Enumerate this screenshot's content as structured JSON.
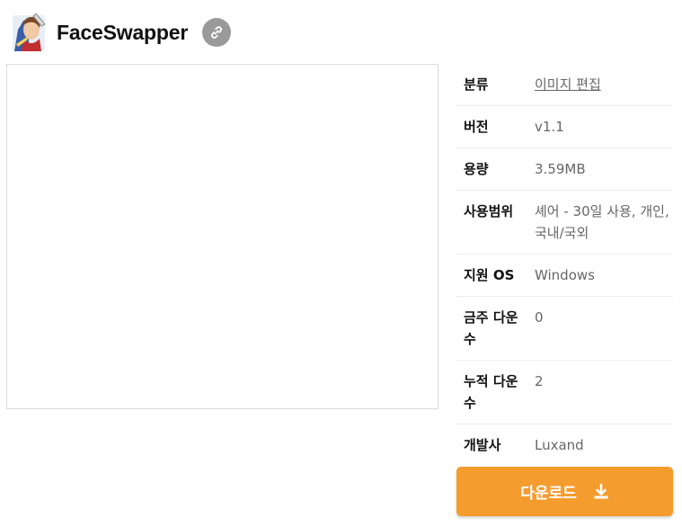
{
  "header": {
    "app_title": "FaceSwapper",
    "app_icon": "faceswapper-app-icon",
    "link_icon": "link-icon"
  },
  "info": {
    "rows": [
      {
        "label": "분류",
        "value": "이미지 편집",
        "is_link": true
      },
      {
        "label": "버전",
        "value": "v1.1"
      },
      {
        "label": "용량",
        "value": "3.59MB"
      },
      {
        "label": "사용범위",
        "value": "셰어 - 30일 사용, 개인, 국내/국외"
      },
      {
        "label": "지원 OS",
        "value": "Windows"
      },
      {
        "label": "금주 다운수",
        "value": "0"
      },
      {
        "label": "누적 다운수",
        "value": "2"
      },
      {
        "label": "개발사",
        "value": "Luxand"
      }
    ]
  },
  "download": {
    "label": "다운로드",
    "icon": "download-icon"
  },
  "colors": {
    "accent": "#f59c2f",
    "link_button": "#9a9a9a"
  }
}
